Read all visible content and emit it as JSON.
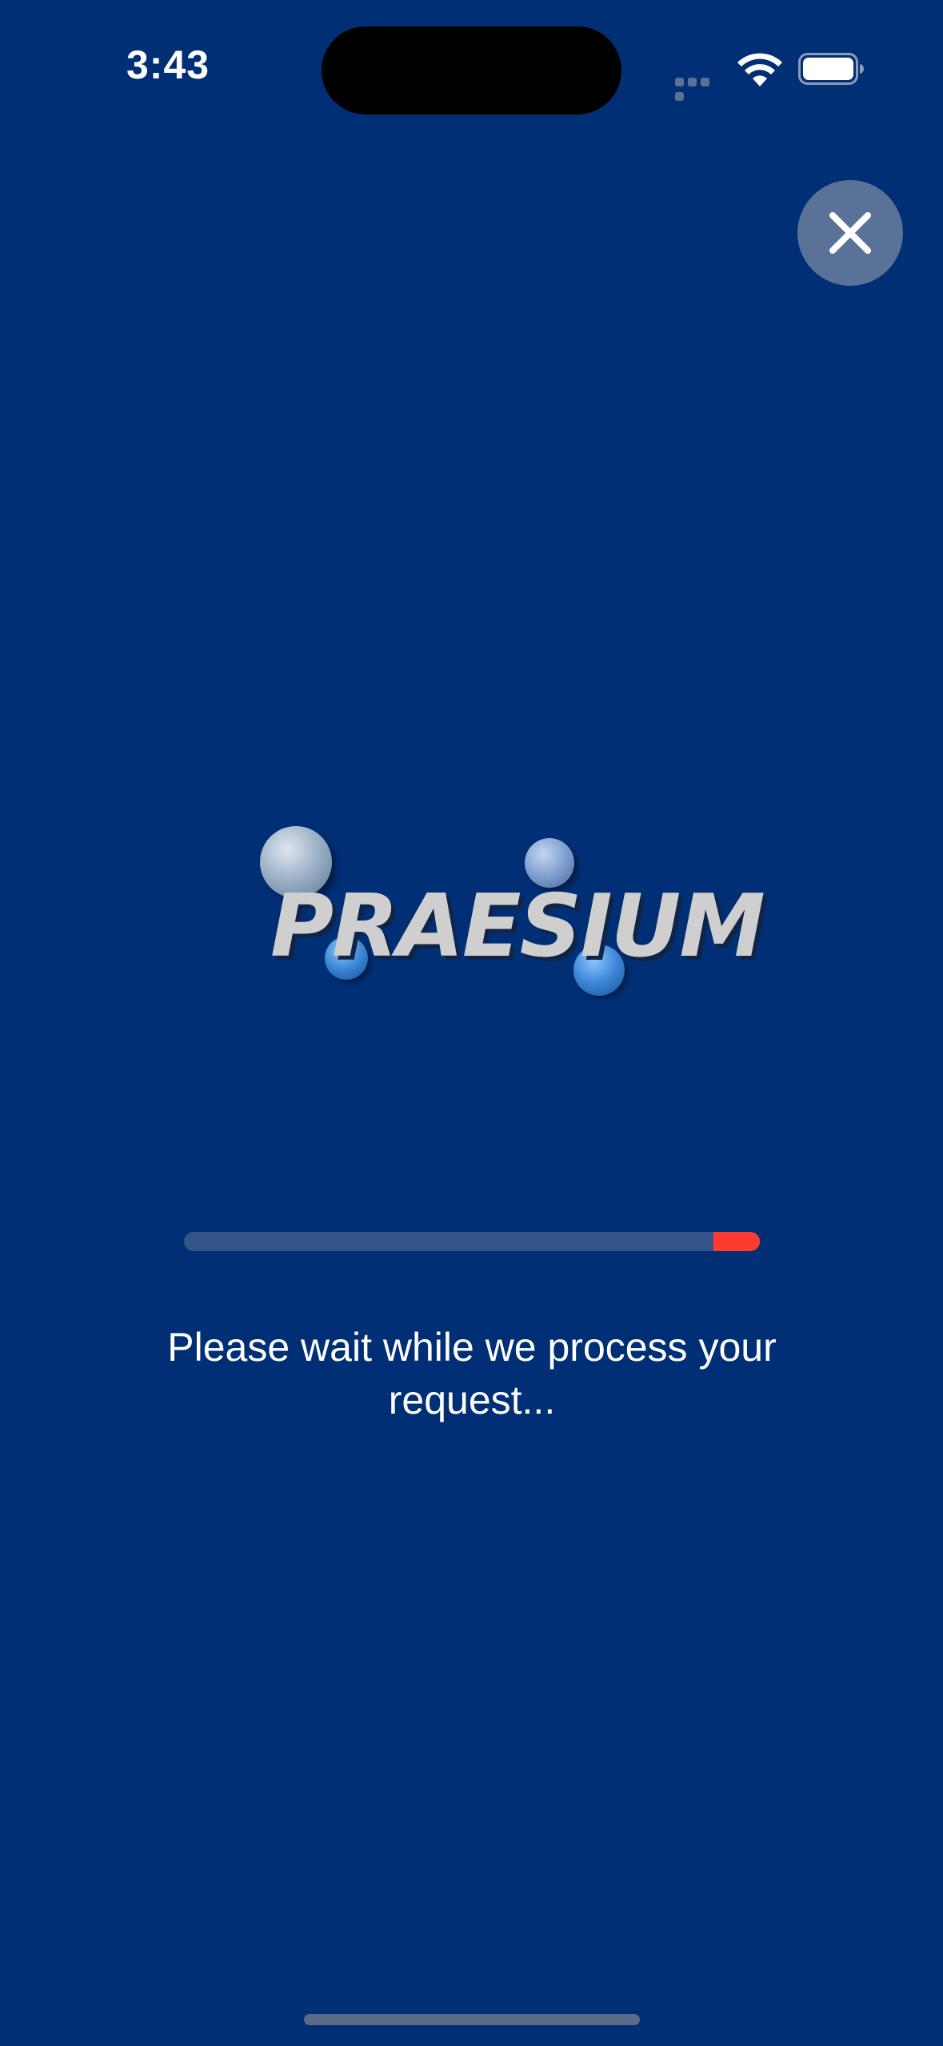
{
  "status_bar": {
    "time": "3:43",
    "icons": [
      "cellular-signal-icon",
      "wifi-icon",
      "battery-icon"
    ]
  },
  "close_button": {
    "icon": "close-icon"
  },
  "logo": {
    "text": "PRAESIUM"
  },
  "progress": {
    "fraction": 0.08,
    "track_color": "#34548a",
    "fill_color": "#ff3b30"
  },
  "message": {
    "text": "Please wait while we process your request..."
  },
  "colors": {
    "background": "#002f76",
    "accent": "#ff3b30"
  }
}
